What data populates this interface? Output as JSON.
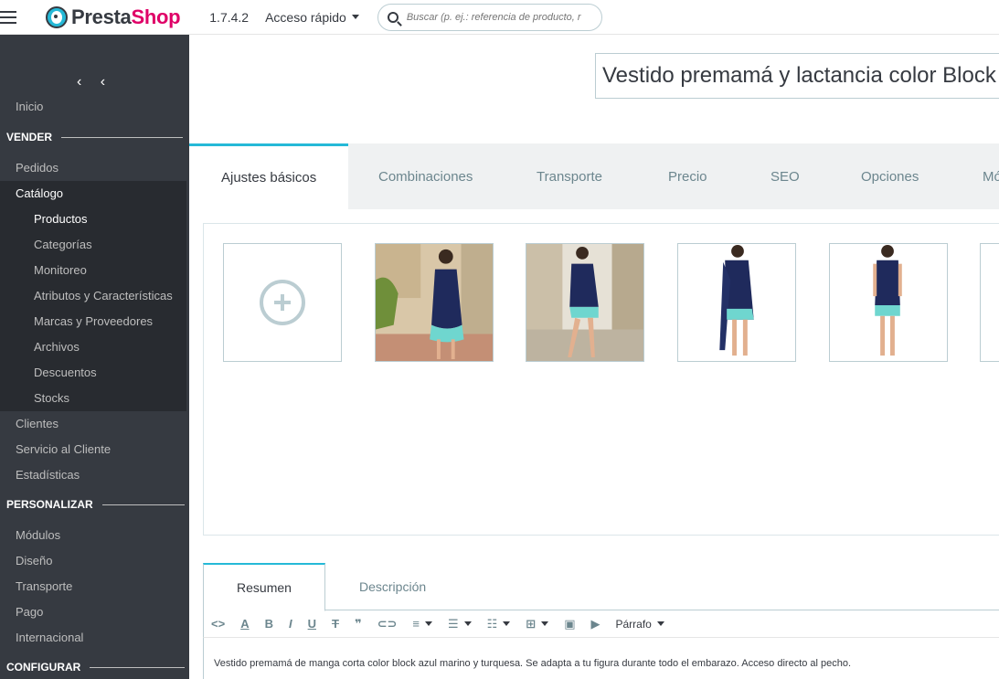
{
  "header": {
    "logo_text_1": "Presta",
    "logo_text_2": "Shop",
    "version": "1.7.4.2",
    "quick_access": "Acceso rápido",
    "search_placeholder": "Buscar (p. ej.: referencia de producto, r"
  },
  "sidebar": {
    "collapse_label": "‹ ‹",
    "inicio": "Inicio",
    "section_vender": "VENDER",
    "pedidos": "Pedidos",
    "catalogo": "Catálogo",
    "catalog_children": [
      "Productos",
      "Categorías",
      "Monitoreo",
      "Atributos y Características",
      "Marcas y Proveedores",
      "Archivos",
      "Descuentos",
      "Stocks"
    ],
    "clientes": "Clientes",
    "servicio": "Servicio al Cliente",
    "estadisticas": "Estadísticas",
    "section_personalizar": "PERSONALIZAR",
    "modulos": "Módulos",
    "diseno": "Diseño",
    "transporte": "Transporte",
    "pago": "Pago",
    "internacional": "Internacional",
    "section_configurar": "CONFIGURAR"
  },
  "product": {
    "name": "Vestido premamá y lactancia  color Block"
  },
  "tabs": [
    "Ajustes básicos",
    "Combinaciones",
    "Transporte",
    "Precio",
    "SEO",
    "Opciones",
    "Mó"
  ],
  "images": {
    "count_shown": 5
  },
  "editor": {
    "tabs": [
      "Resumen",
      "Descripción"
    ],
    "format_label": "Párrafo",
    "content": "Vestido premamá de manga corta color block azul marino y turquesa. Se adapta a tu figura durante todo el embarazo. Acceso directo al pecho."
  },
  "colors": {
    "accent": "#25b9d7",
    "sidebar_bg": "#363a41",
    "brand_pink": "#df0067"
  }
}
